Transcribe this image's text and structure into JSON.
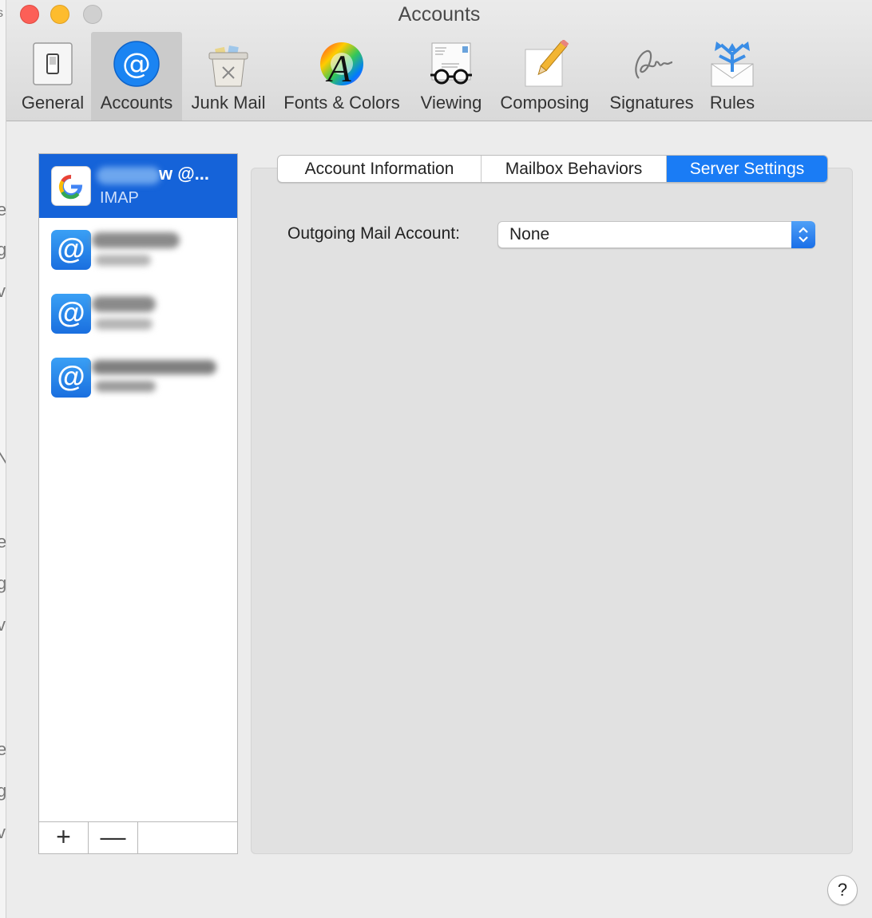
{
  "window": {
    "title": "Accounts"
  },
  "toolbar": {
    "items": [
      {
        "label": "General"
      },
      {
        "label": "Accounts"
      },
      {
        "label": "Junk Mail"
      },
      {
        "label": "Fonts & Colors"
      },
      {
        "label": "Viewing"
      },
      {
        "label": "Composing"
      },
      {
        "label": "Signatures"
      },
      {
        "label": "Rules"
      }
    ],
    "selected": "Accounts"
  },
  "accounts": [
    {
      "name": "w @...",
      "type": "IMAP",
      "icon": "google-icon",
      "selected": true
    },
    {
      "icon": "at-icon"
    },
    {
      "icon": "at-icon"
    },
    {
      "icon": "at-icon"
    }
  ],
  "sidebar_footer": {
    "add_label": "+",
    "remove_label": "—"
  },
  "tabs": [
    {
      "label": "Account Information"
    },
    {
      "label": "Mailbox Behaviors"
    },
    {
      "label": "Server Settings"
    }
  ],
  "active_tab": "Server Settings",
  "server_settings": {
    "outgoing_label": "Outgoing Mail Account:",
    "outgoing_value": "None"
  },
  "help_label": "?",
  "at_glyph": "@",
  "colors": {
    "selection": "#1563d9",
    "active_tab": "#1a7cf5",
    "close": "#fc5f57",
    "minimize": "#fdbc2e"
  }
}
